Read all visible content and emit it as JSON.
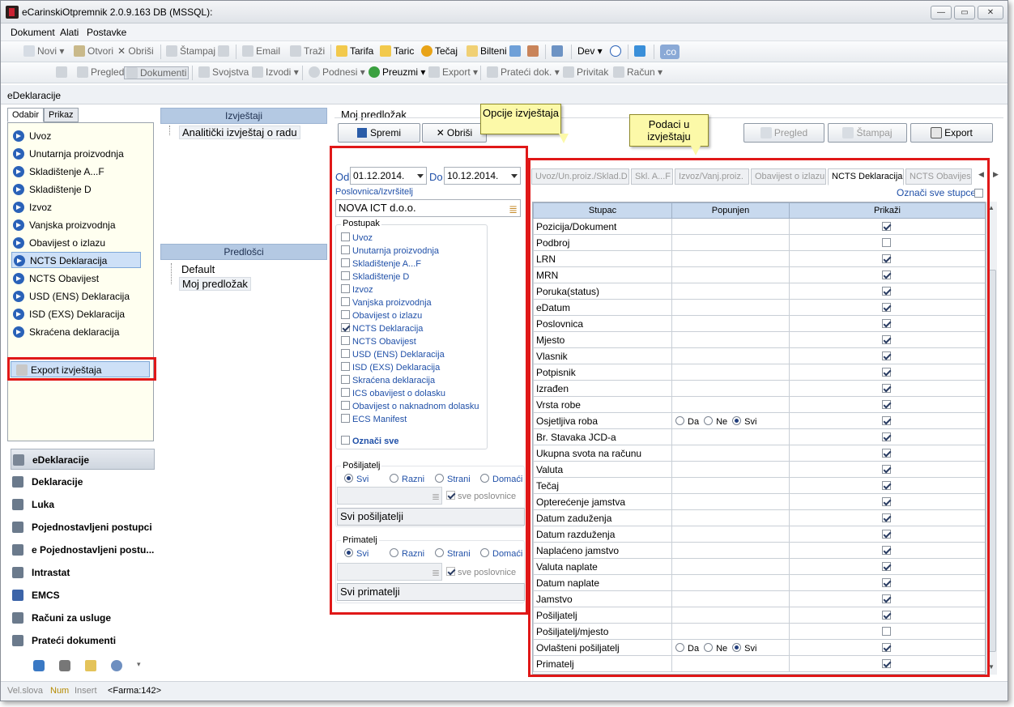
{
  "window": {
    "title": "eCarinskiOtpremnik 2.0.9.163 DB (MSSQL):"
  },
  "menu": [
    "Dokument",
    "Alati",
    "Postavke"
  ],
  "toolbar1": {
    "novi": "Novi",
    "otvori": "Otvori",
    "obrisi": "Obriši",
    "stampaj": "Štampaj",
    "email": "Email",
    "trazi": "Traži",
    "tarifa": "Tarifa",
    "taric": "Taric",
    "tecaj": "Tečaj",
    "bilteni": "Bilteni",
    "dev": "Dev",
    "co": ".co"
  },
  "toolbar2": {
    "pregled": "Pregled",
    "dokumenti": "Dokumenti",
    "svojstva": "Svojstva",
    "izvodi": "Izvodi",
    "podnesi": "Podnesi",
    "preuzmi": "Preuzmi",
    "export": "Export",
    "prateci": "Prateći dok.",
    "privitak": "Privitak",
    "racun": "Račun"
  },
  "header": {
    "title": "eDeklaracije"
  },
  "left_tabs": [
    "Odabir",
    "Prikaz"
  ],
  "left_items": [
    "Uvoz",
    "Unutarnja proizvodnja",
    "Skladištenje A...F",
    "Skladištenje D",
    "Izvoz",
    "Vanjska proizvodnja",
    "Obavijest o izlazu",
    "NCTS Deklaracija",
    "NCTS Obavijest",
    "USD (ENS) Deklaracija",
    "ISD (EXS) Deklaracija",
    "Skraćena deklaracija"
  ],
  "export_item": "Export izvještaja",
  "nav": [
    "eDeklaracije",
    "Deklaracije",
    "Luka",
    "Pojednostavljeni postupci",
    "e Pojednostavljeni postu...",
    "Intrastat",
    "EMCS",
    "Računi za usluge",
    "Prateći dokumenti"
  ],
  "status": {
    "velslova": "Vel.slova",
    "num": "Num",
    "insert": "Insert",
    "farma": "<Farma:142>"
  },
  "reports": {
    "header": "Izvještaji",
    "item": "Analitički izvještaj o radu"
  },
  "templates": {
    "header": "Predlošci",
    "items": [
      "Default",
      "Moj predložak"
    ]
  },
  "form": {
    "title": "Moj predložak",
    "save": "Spremi",
    "delete": "Obriši",
    "preview": "Pregled",
    "print": "Štampaj",
    "export": "Export",
    "od_label": "Od",
    "od_value": "01.12.2014.",
    "do_label": "Do",
    "do_value": "10.12.2014.",
    "poslovnica_label": "Poslovnica/Izvršitelj",
    "poslovnica_value": "NOVA ICT d.o.o.",
    "postupak_title": "Postupak",
    "postupak": [
      {
        "label": "Uvoz",
        "checked": false
      },
      {
        "label": "Unutarnja proizvodnja",
        "checked": false
      },
      {
        "label": "Skladištenje A...F",
        "checked": false
      },
      {
        "label": "Skladištenje D",
        "checked": false
      },
      {
        "label": "Izvoz",
        "checked": false
      },
      {
        "label": "Vanjska proizvodnja",
        "checked": false
      },
      {
        "label": "Obavijest o izlazu",
        "checked": false
      },
      {
        "label": "NCTS Deklaracija",
        "checked": true
      },
      {
        "label": "NCTS Obavijest",
        "checked": false
      },
      {
        "label": "USD (ENS) Deklaracija",
        "checked": false
      },
      {
        "label": "ISD (EXS) Deklaracija",
        "checked": false
      },
      {
        "label": "Skraćena deklaracija",
        "checked": false
      },
      {
        "label": "ICS obavijest o dolasku",
        "checked": false
      },
      {
        "label": "Obavijest o naknadnom dolasku",
        "checked": false
      },
      {
        "label": "ECS Manifest",
        "checked": false
      }
    ],
    "oznaci_sve": "Označi sve",
    "posiljatelj": {
      "title": "Pošiljatelj",
      "options": [
        "Svi",
        "Razni",
        "Strani",
        "Domaći"
      ],
      "selected": "Svi",
      "sve_poslovnice": "sve poslovnice",
      "value": "Svi pošiljatelji"
    },
    "primatelj": {
      "title": "Primatelj",
      "options": [
        "Svi",
        "Razni",
        "Strani",
        "Domaći"
      ],
      "selected": "Svi",
      "sve_poslovnice": "sve poslovnice",
      "value": "Svi primatelji"
    }
  },
  "callouts": {
    "opcije": "Opcije izvještaja",
    "podaci": "Podaci u izvještaju"
  },
  "data_tabs": [
    "Uvoz/Un.proiz./Sklad.D",
    "Skl. A...F",
    "Izvoz/Vanj.proiz.",
    "Obavijest o izlazu",
    "NCTS Deklaracija",
    "NCTS Obavijest"
  ],
  "active_data_tab": "NCTS Deklaracija",
  "oznaci_sve_stupce": "Označi sve stupce",
  "grid": {
    "columns": [
      "Stupac",
      "Popunjen",
      "Prikaži"
    ],
    "radio_labels": [
      "Da",
      "Ne",
      "Svi"
    ],
    "rows": [
      {
        "name": "Pozicija/Dokument",
        "show": true
      },
      {
        "name": "Podbroj",
        "show": false
      },
      {
        "name": "LRN",
        "show": true
      },
      {
        "name": "MRN",
        "show": true
      },
      {
        "name": "Poruka(status)",
        "show": true
      },
      {
        "name": "eDatum",
        "show": true
      },
      {
        "name": "Poslovnica",
        "show": true
      },
      {
        "name": "Mjesto",
        "show": true
      },
      {
        "name": "Vlasnik",
        "show": true
      },
      {
        "name": "Potpisnik",
        "show": true
      },
      {
        "name": "Izrađen",
        "show": true
      },
      {
        "name": "Vrsta robe",
        "show": true
      },
      {
        "name": "Osjetljiva roba",
        "show": true,
        "radio": "Svi"
      },
      {
        "name": "Br. Stavaka JCD-a",
        "show": true
      },
      {
        "name": "Ukupna svota na računu",
        "show": true
      },
      {
        "name": "Valuta",
        "show": true
      },
      {
        "name": "Tečaj",
        "show": true
      },
      {
        "name": "Opterećenje jamstva",
        "show": true
      },
      {
        "name": "Datum zaduženja",
        "show": true
      },
      {
        "name": "Datum razduženja",
        "show": true
      },
      {
        "name": "Naplaćeno jamstvo",
        "show": true
      },
      {
        "name": "Valuta naplate",
        "show": true
      },
      {
        "name": "Datum naplate",
        "show": true
      },
      {
        "name": "Jamstvo",
        "show": true
      },
      {
        "name": "Pošiljatelj",
        "show": true
      },
      {
        "name": "Pošiljatelj/mjesto",
        "show": false
      },
      {
        "name": "Ovlašteni pošiljatelj",
        "show": true,
        "radio": "Svi"
      },
      {
        "name": "Primatelj",
        "show": true
      }
    ]
  }
}
